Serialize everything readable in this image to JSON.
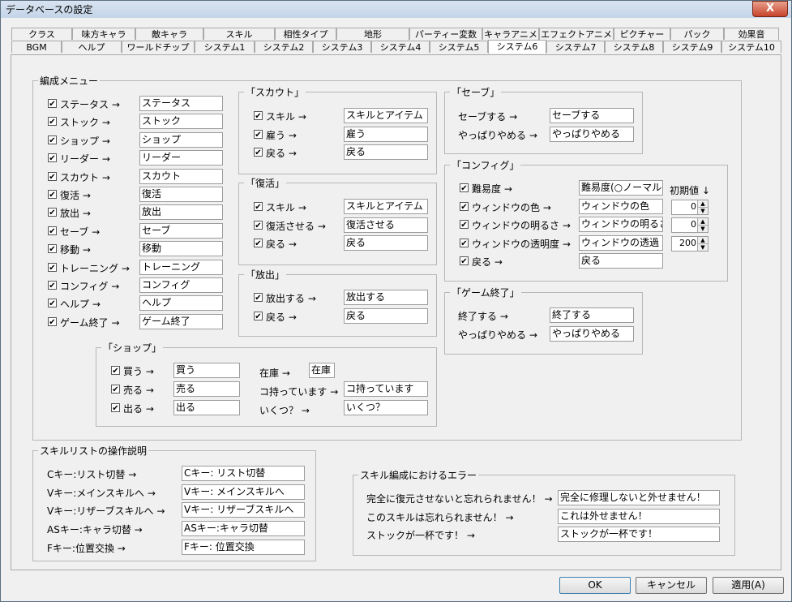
{
  "window": {
    "title": "データベースの設定",
    "close_glyph": "X"
  },
  "tabs_row1": [
    "クラス",
    "味方キャラ",
    "敵キャラ",
    "スキル",
    "相性タイプ",
    "地形",
    "パーティー変数",
    "キャラアニメ",
    "エフェクトアニメ",
    "ピクチャー",
    "パック",
    "効果音"
  ],
  "tabs_row2": [
    "BGM",
    "ヘルプ",
    "ワールドチップ",
    "システム1",
    "システム2",
    "システム3",
    "システム4",
    "システム5",
    "システム6",
    "システム7",
    "システム8",
    "システム9",
    "システム10"
  ],
  "active_tab": "システム6",
  "menu": {
    "title": "編成メニュー",
    "items": [
      {
        "label": "ステータス →",
        "value": "ステータス"
      },
      {
        "label": "ストック →",
        "value": "ストック"
      },
      {
        "label": "ショップ →",
        "value": "ショップ"
      },
      {
        "label": "リーダー →",
        "value": "リーダー"
      },
      {
        "label": "スカウト →",
        "value": "スカウト"
      },
      {
        "label": "復活 →",
        "value": "復活"
      },
      {
        "label": "放出 →",
        "value": "放出"
      },
      {
        "label": "セーブ →",
        "value": "セーブ"
      },
      {
        "label": "移動 →",
        "value": "移動"
      },
      {
        "label": "トレーニング →",
        "value": "トレーニング"
      },
      {
        "label": "コンフィグ →",
        "value": "コンフィグ"
      },
      {
        "label": "ヘルプ →",
        "value": "ヘルプ"
      },
      {
        "label": "ゲーム終了 →",
        "value": "ゲーム終了"
      }
    ]
  },
  "scout": {
    "title": "「スカウト」",
    "items": [
      {
        "label": "スキル →",
        "value": "スキルとアイテム"
      },
      {
        "label": "雇う →",
        "value": "雇う"
      },
      {
        "label": "戻る →",
        "value": "戻る"
      }
    ]
  },
  "revive": {
    "title": "「復活」",
    "items": [
      {
        "label": "スキル →",
        "value": "スキルとアイテム"
      },
      {
        "label": "復活させる →",
        "value": "復活させる"
      },
      {
        "label": "戻る →",
        "value": "戻る"
      }
    ]
  },
  "release": {
    "title": "「放出」",
    "items": [
      {
        "label": "放出する →",
        "value": "放出する"
      },
      {
        "label": "戻る →",
        "value": "戻る"
      }
    ]
  },
  "shop": {
    "title": "「ショップ」",
    "items": [
      {
        "label": "買う →",
        "value": "買う"
      },
      {
        "label": "売る →",
        "value": "売る"
      },
      {
        "label": "出る →",
        "value": "出る"
      }
    ],
    "extra": [
      {
        "label": "在庫 →",
        "value": "在庫"
      },
      {
        "label": "コ持っています →",
        "value": "コ持っています"
      },
      {
        "label": "いくつ？ →",
        "value": "いくつ？"
      }
    ]
  },
  "save": {
    "title": "「セーブ」",
    "items": [
      {
        "label": "セーブする →",
        "value": "セーブする"
      },
      {
        "label": "やっぱりやめる →",
        "value": "やっぱりやめる"
      }
    ]
  },
  "config": {
    "title": "「コンフィグ」",
    "init_label": "初期値 ↓",
    "items": [
      {
        "label": "難易度 →",
        "value": "難易度(○ノーマル-"
      },
      {
        "label": "ウィンドウの色 →",
        "value": "ウィンドウの色",
        "init": "0"
      },
      {
        "label": "ウィンドウの明るさ →",
        "value": "ウィンドウの明るさ",
        "init": "0"
      },
      {
        "label": "ウィンドウの透明度 →",
        "value": "ウィンドウの透過",
        "init": "200"
      },
      {
        "label": "戻る →",
        "value": "戻る"
      }
    ]
  },
  "gameend": {
    "title": "「ゲーム終了」",
    "items": [
      {
        "label": "終了する →",
        "value": "終了する"
      },
      {
        "label": "やっぱりやめる →",
        "value": "やっぱりやめる"
      }
    ]
  },
  "skilllist": {
    "title": "スキルリストの操作説明",
    "items": [
      {
        "label": "Cキー:リスト切替 →",
        "value": "Cキー: リスト切替"
      },
      {
        "label": "Vキー:メインスキルへ →",
        "value": "Vキー: メインスキルへ"
      },
      {
        "label": "Vキー:リザーブスキルへ →",
        "value": "Vキー: リザーブスキルへ"
      },
      {
        "label": "ASキー:キャラ切替 →",
        "value": "ASキー:キャラ切替"
      },
      {
        "label": "Fキー:位置交換 →",
        "value": "Fキー: 位置交換"
      }
    ]
  },
  "skillerr": {
    "title": "スキル編成におけるエラー",
    "items": [
      {
        "label": "完全に復元させないと忘れられません！ →",
        "value": "完全に修理しないと外せません！"
      },
      {
        "label": "このスキルは忘れられません！ →",
        "value": "これは外せません！"
      },
      {
        "label": "ストックが一杯です！ →",
        "value": "ストックが一杯です！"
      }
    ]
  },
  "buttons": {
    "ok": "OK",
    "cancel": "キャンセル",
    "apply": "適用(A)"
  },
  "check_glyph": "✔"
}
